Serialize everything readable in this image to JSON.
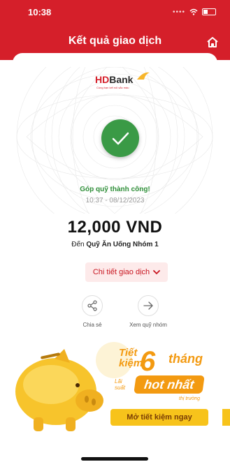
{
  "status_bar": {
    "time": "10:38"
  },
  "header": {
    "title": "Kết quả giao dịch"
  },
  "brand": {
    "logo_hd": "HD",
    "logo_bank": "Bank",
    "tagline": "Cùng bạn kết nối sắc màu",
    "color": "#d51f2a"
  },
  "result": {
    "status_text": "Góp quỹ thành công!",
    "timestamp": "10:37 - 08/12/2023",
    "amount": "12,000 VND",
    "destination_prefix": "Đến",
    "destination_name": "Quỹ Ăn Uống Nhóm 1",
    "success_color": "#3a9a46"
  },
  "buttons": {
    "detail_label": "Chi tiết giao dịch"
  },
  "actions": [
    {
      "label": "Chia sẻ",
      "icon": "share-icon"
    },
    {
      "label": "Xem quỹ nhóm",
      "icon": "arrow-right-icon"
    }
  ],
  "promo": {
    "line1": "Tiết",
    "line2": "kiệm",
    "number": "6",
    "unit": "tháng",
    "lai": "Lãi",
    "suat": "suất",
    "highlight": "hot nhất",
    "market": "thị trường",
    "cta": "Mở tiết kiệm ngay"
  }
}
